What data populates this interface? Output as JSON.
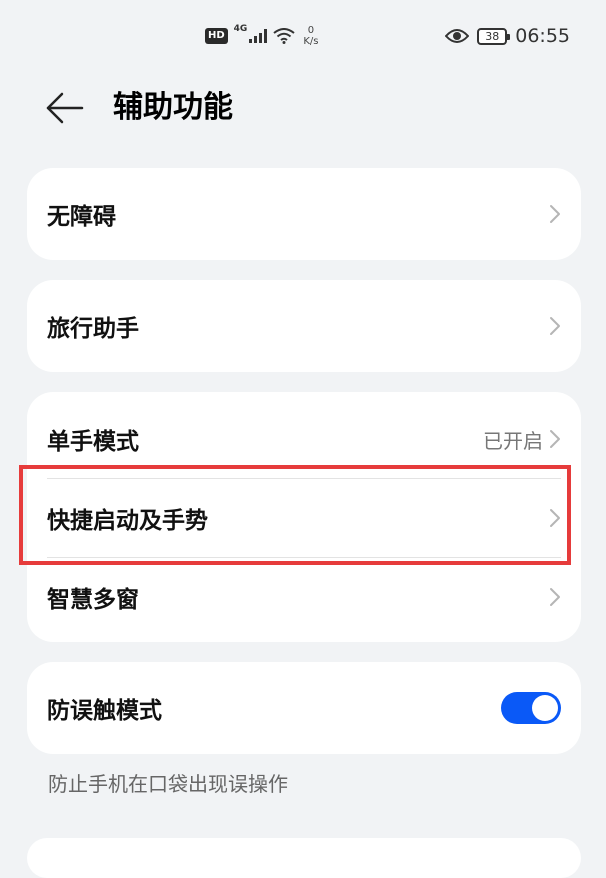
{
  "status_bar": {
    "hd": "HD",
    "network": "4G",
    "speed_value": "0",
    "speed_unit": "K/s",
    "battery": "38",
    "time": "06:55",
    "icons": [
      "hd-icon",
      "signal-icon",
      "wifi-icon",
      "eye-icon",
      "battery-icon"
    ]
  },
  "header": {
    "title": "辅助功能",
    "back_icon": "arrow-left-icon"
  },
  "groups": [
    {
      "items": [
        {
          "label": "无障碍"
        }
      ]
    },
    {
      "items": [
        {
          "label": "旅行助手"
        }
      ]
    },
    {
      "items": [
        {
          "label": "单手模式",
          "value": "已开启"
        },
        {
          "label": "快捷启动及手势",
          "highlighted": true
        },
        {
          "label": "智慧多窗"
        }
      ]
    },
    {
      "items": [
        {
          "label": "防误触模式",
          "toggle": "on"
        }
      ]
    }
  ],
  "description": "防止手机在口袋出现误操作",
  "colors": {
    "background": "#f1f3f5",
    "card": "#ffffff",
    "toggle_on": "#0a59f7",
    "highlight_border": "#e63b3b"
  }
}
